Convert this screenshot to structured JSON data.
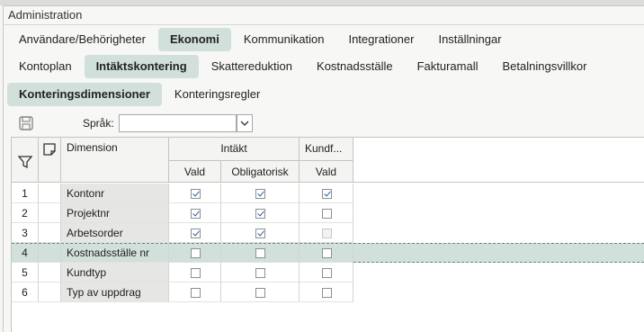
{
  "window": {
    "title": "Administration"
  },
  "tabs_level1": [
    {
      "label": "Användare/Behörigheter",
      "active": false
    },
    {
      "label": "Ekonomi",
      "active": true
    },
    {
      "label": "Kommunikation",
      "active": false
    },
    {
      "label": "Integrationer",
      "active": false
    },
    {
      "label": "Inställningar",
      "active": false
    }
  ],
  "tabs_level2": [
    {
      "label": "Kontoplan",
      "active": false
    },
    {
      "label": "Intäktskontering",
      "active": true
    },
    {
      "label": "Skattereduktion",
      "active": false
    },
    {
      "label": "Kostnadsställe",
      "active": false
    },
    {
      "label": "Fakturamall",
      "active": false
    },
    {
      "label": "Betalningsvillkor",
      "active": false
    }
  ],
  "tabs_level3": [
    {
      "label": "Konteringsdimensioner",
      "active": true
    },
    {
      "label": "Konteringsregler",
      "active": false
    }
  ],
  "toolbar": {
    "save_icon": "save-icon",
    "language_label": "Språk:",
    "language_value": ""
  },
  "grid": {
    "columns": {
      "dimension": "Dimension",
      "intakt_group": "Intäkt",
      "kund_group": "Kundf...",
      "vald": "Vald",
      "obligatorisk": "Obligatorisk",
      "kund_vald": "Vald"
    },
    "rows": [
      {
        "num": "1",
        "name": "Kontonr",
        "vald": true,
        "oblig": true,
        "kund": true,
        "kund_disabled": false
      },
      {
        "num": "2",
        "name": "Projektnr",
        "vald": true,
        "oblig": true,
        "kund": false,
        "kund_disabled": false
      },
      {
        "num": "3",
        "name": "Arbetsorder",
        "vald": true,
        "oblig": true,
        "kund": false,
        "kund_disabled": true
      },
      {
        "num": "4",
        "name": "Kostnadsställe nr",
        "vald": false,
        "oblig": false,
        "kund": false,
        "kund_disabled": false,
        "selected": true
      },
      {
        "num": "5",
        "name": "Kundtyp",
        "vald": false,
        "oblig": false,
        "kund": false,
        "kund_disabled": false
      },
      {
        "num": "6",
        "name": "Typ av uppdrag",
        "vald": false,
        "oblig": false,
        "kund": false,
        "kund_disabled": false
      }
    ]
  }
}
